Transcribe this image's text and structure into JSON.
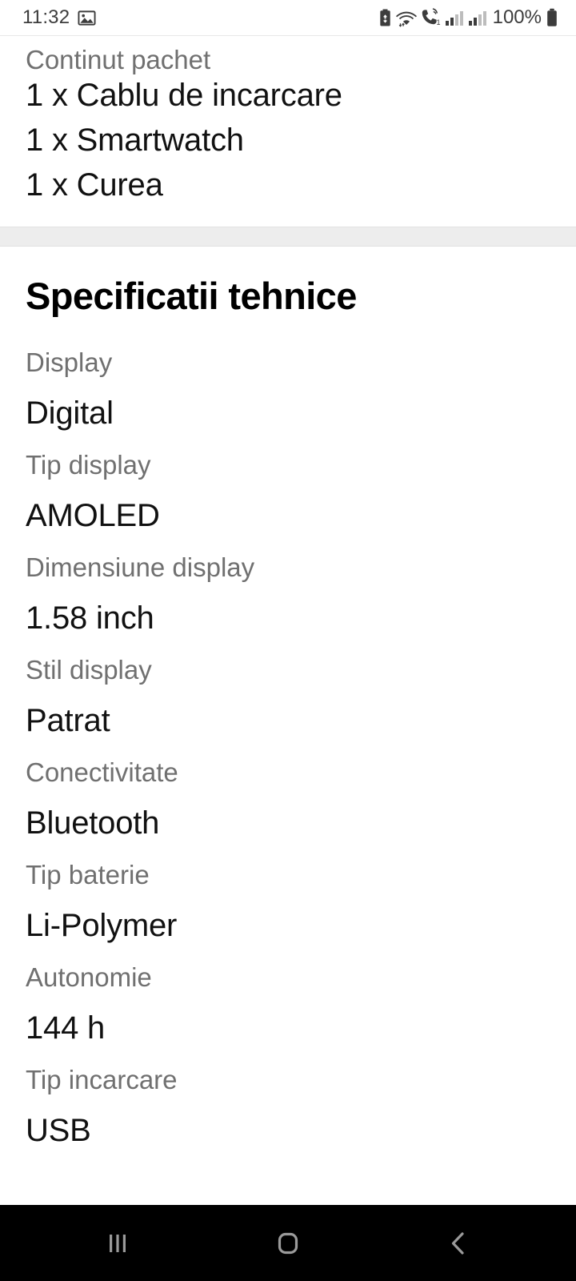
{
  "status_bar": {
    "time": "11:32",
    "battery_percent": "100%",
    "icons": [
      "screenshot-image-icon",
      "data-saver-icon",
      "wifi-icon",
      "volte-call-icon",
      "signal-sim1-icon",
      "signal-sim2-icon",
      "battery-icon"
    ]
  },
  "package_section": {
    "title": "Continut pachet",
    "items": [
      "1 x Cablu de incarcare",
      "1 x Smartwatch",
      "1 x Curea"
    ]
  },
  "specs_section": {
    "heading": "Specificatii tehnice",
    "rows": [
      {
        "label": "Display",
        "value": "Digital"
      },
      {
        "label": "Tip display",
        "value": "AMOLED"
      },
      {
        "label": "Dimensiune display",
        "value": "1.58 inch"
      },
      {
        "label": "Stil display",
        "value": "Patrat"
      },
      {
        "label": "Conectivitate",
        "value": "Bluetooth"
      },
      {
        "label": "Tip baterie",
        "value": "Li-Polymer"
      },
      {
        "label": "Autonomie",
        "value": "144 h"
      },
      {
        "label": "Tip incarcare",
        "value": "USB"
      }
    ]
  },
  "nav_bar": {
    "recents_label": "recents-button",
    "home_label": "home-button",
    "back_label": "back-button"
  },
  "colors": {
    "label_gray": "#707070",
    "value_black": "#111111",
    "divider_gray": "#ededed",
    "nav_bg": "#000000",
    "nav_icon": "#9a9a9a"
  }
}
